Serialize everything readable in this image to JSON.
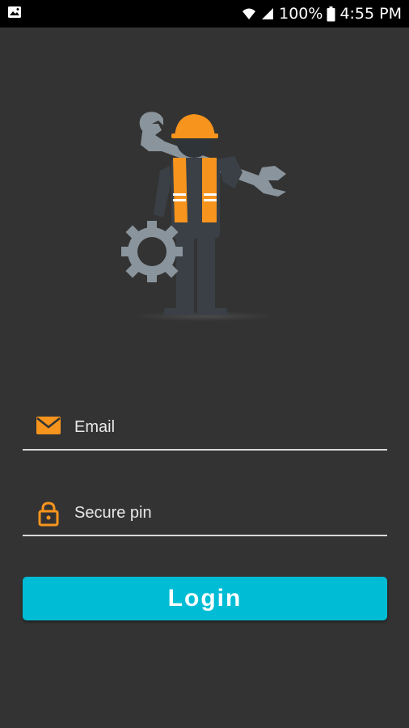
{
  "status_bar": {
    "battery": "100%",
    "time": "4:55 PM",
    "icons": [
      "gallery-notification-icon",
      "wifi-icon",
      "signal-icon",
      "battery-icon"
    ]
  },
  "illustration": {
    "name": "worker-with-wrench-and-gear",
    "accent_color": "#f7941d",
    "figure_color": "#3a4046",
    "tool_color": "#8a949c"
  },
  "form": {
    "email": {
      "placeholder": "Email",
      "value": "",
      "icon": "envelope-icon"
    },
    "pin": {
      "placeholder": "Secure pin",
      "value": "",
      "icon": "lock-icon"
    },
    "login_label": "Login"
  },
  "colors": {
    "background": "#333333",
    "button": "#00bcd4",
    "icon_accent": "#f7941d"
  }
}
